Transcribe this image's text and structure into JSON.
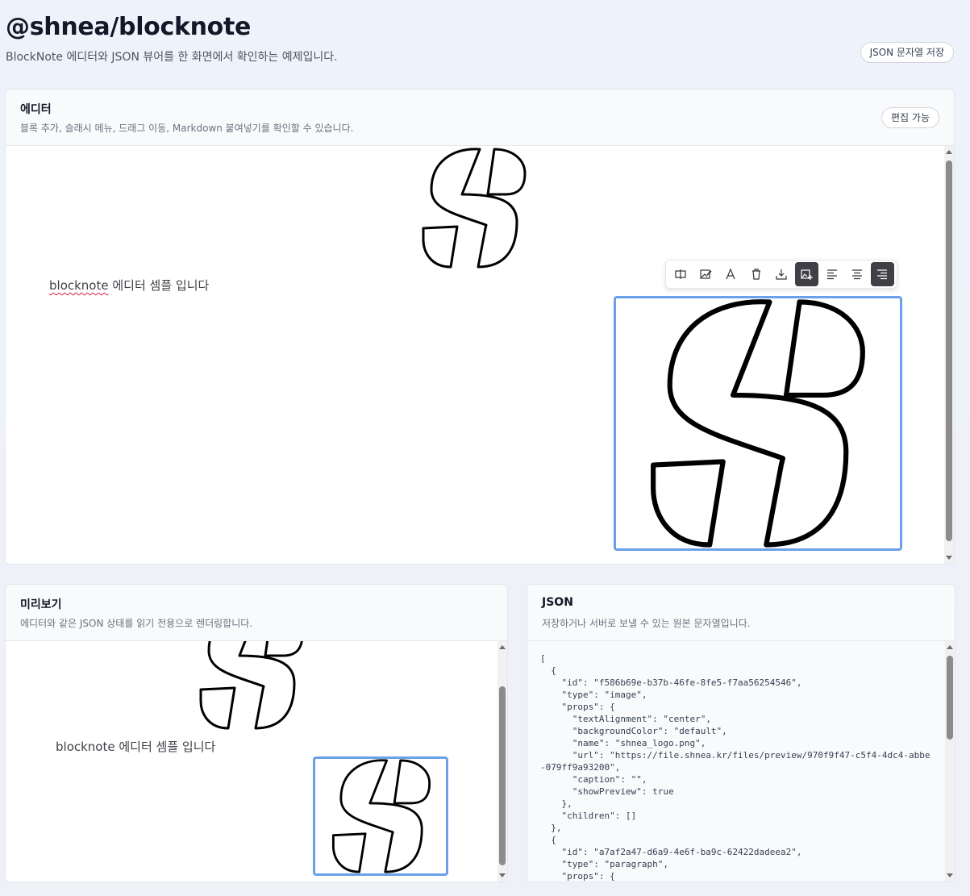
{
  "page": {
    "title": "@shnea/blocknote",
    "subtitle": "BlockNote 에디터와 JSON 뷰어를 한 화면에서 확인하는 예제입니다.",
    "save_button": "JSON 문자열 저장"
  },
  "editor": {
    "title": "에디터",
    "description": "블록 추가, 슬래시 메뉴, 드래그 이동, Markdown 붙여넣기를 확인할 수 있습니다.",
    "badge": "편집 가능",
    "paragraph_word": "blocknote",
    "paragraph_rest": " 에디터 셈플 입니다",
    "toolbar_icons": [
      "replace-image-icon",
      "image-edit-icon",
      "text-color-icon",
      "delete-icon",
      "download-icon",
      "image-preview-icon",
      "align-left-icon",
      "align-center-icon",
      "align-right-icon"
    ]
  },
  "preview": {
    "title": "미리보기",
    "description": "에디터와 같은 JSON 상태를 읽기 전용으로 렌더링합니다.",
    "paragraph": "blocknote 에디터 셈플 입니다"
  },
  "json": {
    "title": "JSON",
    "description": "저장하거나 서버로 보낼 수 있는 원본 문자열입니다.",
    "content": "[\n  {\n    \"id\": \"f586b69e-b37b-46fe-8fe5-f7aa56254546\",\n    \"type\": \"image\",\n    \"props\": {\n      \"textAlignment\": \"center\",\n      \"backgroundColor\": \"default\",\n      \"name\": \"shnea_logo.png\",\n      \"url\": \"https://file.shnea.kr/files/preview/970f9f47-c5f4-4dc4-abbe-079ff9a93200\",\n      \"caption\": \"\",\n      \"showPreview\": true\n    },\n    \"children\": []\n  },\n  {\n    \"id\": \"a7af2a47-d6a9-4e6f-ba9c-62422dadeea2\",\n    \"type\": \"paragraph\",\n    \"props\": {"
  },
  "colors": {
    "accent_frame": "#6aa0ea",
    "toolbar_active": "#3f3f46"
  }
}
